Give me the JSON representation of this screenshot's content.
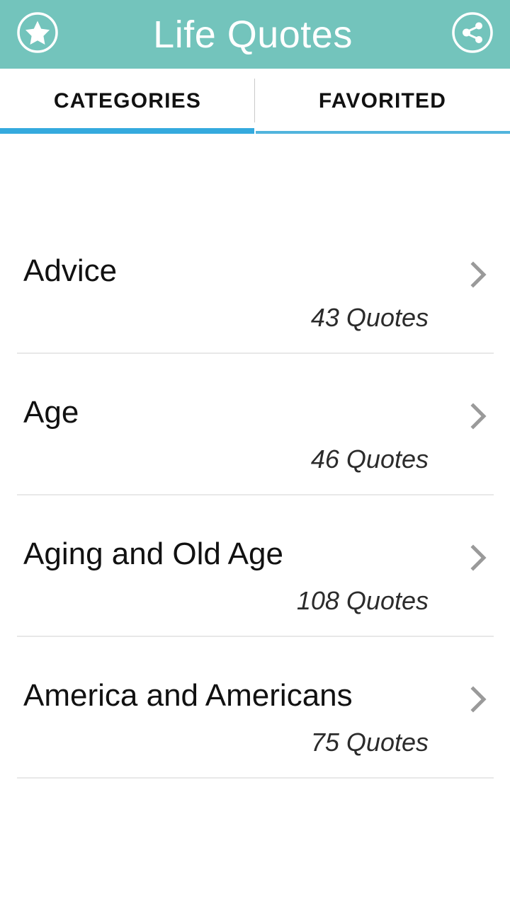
{
  "appbar": {
    "title": "Life Quotes",
    "background_color": "#73c4bc",
    "left_action": {
      "name": "favorites",
      "icon": "star-in-circle-icon"
    },
    "right_action": {
      "name": "share",
      "icon": "share-in-circle-icon"
    }
  },
  "tabs": {
    "active_index": 0,
    "active_color": "#35aade",
    "inactive_color": "#51b4dd",
    "items": [
      {
        "label": "CATEGORIES"
      },
      {
        "label": "FAVORITED"
      }
    ]
  },
  "search": {
    "icon": "search-icon",
    "value": "",
    "placeholder": "",
    "underline_color": "#0b96c0",
    "focused": true
  },
  "list": {
    "chevron_icon": "chevron-right-icon",
    "count_suffix": "Quotes",
    "items": [
      {
        "name": "Advice",
        "count": "43 Quotes"
      },
      {
        "name": "Age",
        "count": "46 Quotes"
      },
      {
        "name": "Aging and Old Age",
        "count": "108 Quotes"
      },
      {
        "name": "America and Americans",
        "count": "75 Quotes"
      }
    ]
  }
}
